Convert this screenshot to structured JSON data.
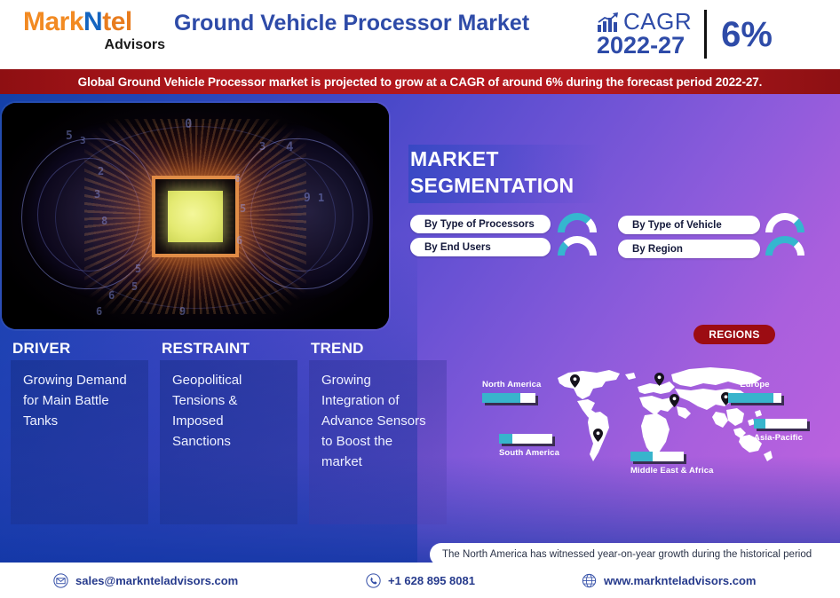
{
  "header": {
    "logo": {
      "part1": "Mark",
      "part2": "N",
      "part3": "tel",
      "sub": "Advisors"
    },
    "title": "Ground Vehicle Processor Market",
    "cagr": {
      "icon": "growth-chart-icon",
      "label": "CAGR",
      "period": "2022-27",
      "value": "6%"
    }
  },
  "banner": {
    "text": "Global Ground Vehicle Processor market is projected to grow at a CAGR of around 6% during the forecast period 2022-27."
  },
  "hero": {
    "alt": "brain-circuit-processor-image"
  },
  "segmentation": {
    "title_line1": "MARKET",
    "title_line2": "SEGMENTATION",
    "items": [
      {
        "label": "By Type of Processors"
      },
      {
        "label": "By End Users"
      },
      {
        "label": "By Type of Vehicle"
      },
      {
        "label": "By Region"
      }
    ]
  },
  "factors": [
    {
      "heading": "DRIVER",
      "text": "Growing Demand for Main Battle Tanks"
    },
    {
      "heading": "RESTRAINT",
      "text": "Geopolitical Tensions & Imposed Sanctions"
    },
    {
      "heading": "TREND",
      "text": "Growing Integration of Advance Sensors to Boost the market"
    }
  ],
  "regions": {
    "badge": "REGIONS",
    "items": [
      {
        "name": "North America",
        "fill_pct": 72
      },
      {
        "name": "South America",
        "fill_pct": 25
      },
      {
        "name": "Europe",
        "fill_pct": 85
      },
      {
        "name": "Asia-Pacific",
        "fill_pct": 22
      },
      {
        "name": "Middle East & Africa",
        "fill_pct": 42
      }
    ]
  },
  "callout": {
    "text": "The North America has witnessed year-on-year growth during the historical period"
  },
  "footer": {
    "email": "sales@marknteladvisors.com",
    "phone": "+1 628 895 8081",
    "website": "www.marknteladvisors.com"
  },
  "colors": {
    "brand_blue": "#2e4ba8",
    "brand_orange": "#f28a22",
    "banner_red": "#b0171c",
    "regions_badge": "#9c0c12",
    "teal": "#38b4cc",
    "gradient_start": "#1340a8",
    "gradient_end": "#c163df"
  }
}
